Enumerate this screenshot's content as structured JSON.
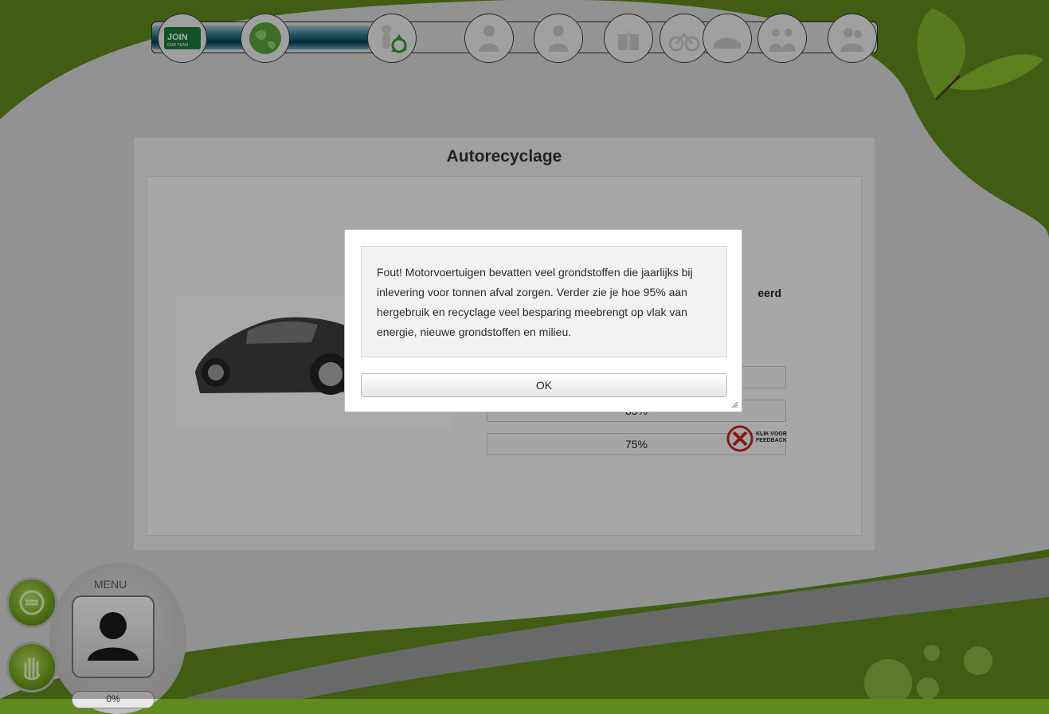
{
  "colors": {
    "grass_green": "#5f8a1c",
    "track_fill_blue": "#1f6f86",
    "card_bg": "#ececec",
    "modal_bg": "#ffffff"
  },
  "progress": {
    "filled_fraction": 0.3
  },
  "milestones": [
    {
      "name": "join-our-team",
      "icon": "join-our-team-icon",
      "label_line1": "JOIN",
      "label_line2": "OUR TEAM",
      "state": "done"
    },
    {
      "name": "world",
      "icon": "globe-icon",
      "state": "done"
    },
    {
      "name": "recycling",
      "icon": "recycle-person-icon",
      "state": "current"
    },
    {
      "name": "step-4",
      "icon": "person-silhouette-icon",
      "state": "locked"
    },
    {
      "name": "step-5",
      "icon": "person-silhouette-icon",
      "state": "locked"
    },
    {
      "name": "step-6",
      "icon": "gift-icon",
      "state": "locked"
    },
    {
      "name": "step-7",
      "icon": "bicycle-icon",
      "state": "locked"
    },
    {
      "name": "step-8",
      "icon": "hands-icon",
      "state": "locked"
    },
    {
      "name": "step-9",
      "icon": "group-icon",
      "state": "locked"
    },
    {
      "name": "step-10",
      "icon": "hug-icon",
      "state": "locked"
    }
  ],
  "card": {
    "title": "Autorecyclage",
    "question_fragment": "eerd",
    "answers": [
      "",
      "85%",
      "75%"
    ],
    "feedback_badge": {
      "icon": "wrong-x-icon",
      "text_line1": "KLIK VOOR",
      "text_line2": "FEEDBACK"
    }
  },
  "menu": {
    "label": "MENU",
    "avatar_icon": "user-silhouette-icon",
    "buttons": [
      {
        "name": "refresh-button",
        "icon": "refresh-icon"
      },
      {
        "name": "help-button",
        "icon": "hand-icon"
      }
    ],
    "progress_text": "0%"
  },
  "modal": {
    "message": "Fout! Motorvoertuigen bevatten veel grondstoffen die jaarlijks bij inlevering voor tonnen afval zorgen. Verder zie je hoe 95% aan hergebruik en recyclage veel besparing meebrengt op vlak van energie, nieuwe grondstoffen en milieu.",
    "ok_label": "OK"
  }
}
